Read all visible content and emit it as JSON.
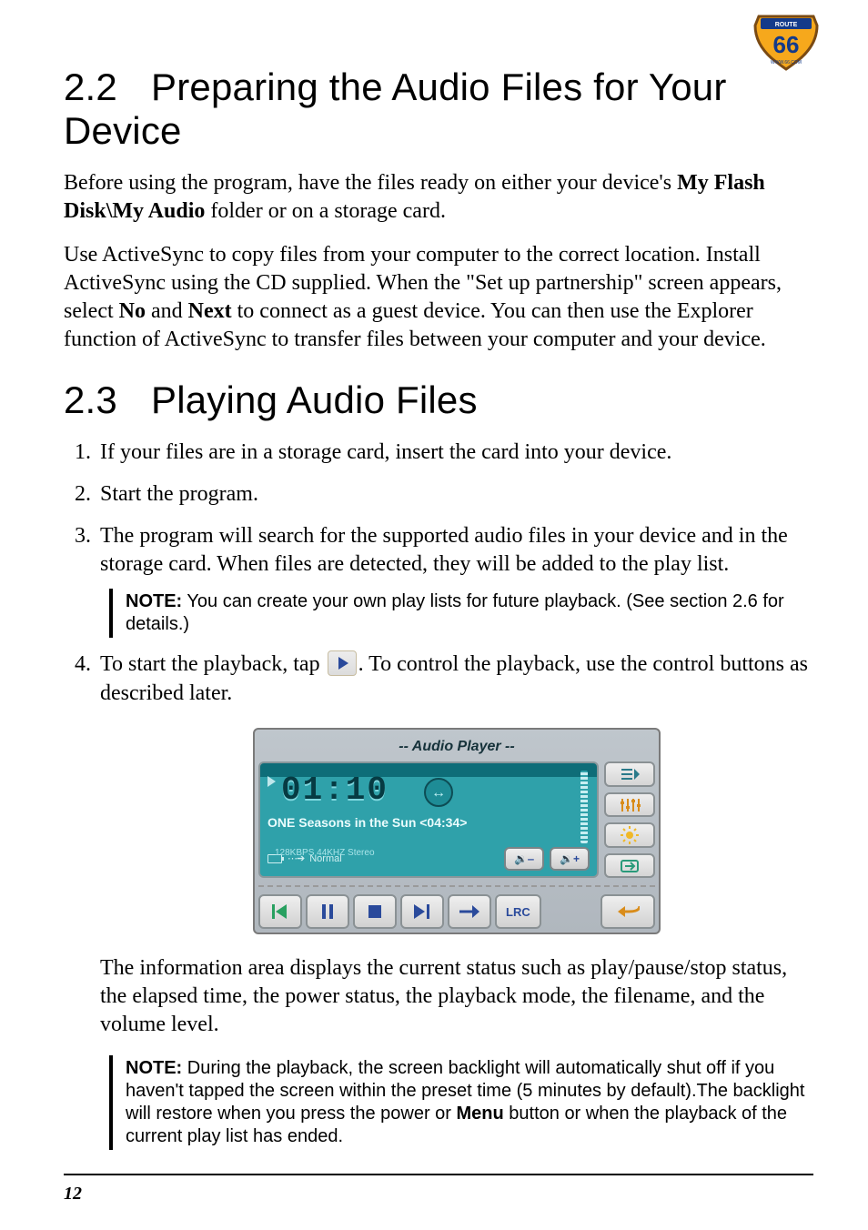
{
  "logo": {
    "route": "ROUTE",
    "num": "66",
    "url": "WWW.66.COM"
  },
  "section22": {
    "num": "2.2",
    "title": "Preparing the Audio Files for Your Device",
    "p1_a": "Before using the program, have the files ready on either your device's ",
    "p1_b": "My Flash Disk\\My Audio",
    "p1_c": " folder or on a storage card.",
    "p2": "Use ActiveSync to copy files from your computer to the correct location. Install ActiveSync using the CD supplied. When the \"Set up partnership\" screen appears, select ",
    "p2_no": "No",
    "p2_mid": " and ",
    "p2_next": "Next",
    "p2_tail": " to connect as a guest device. You can then use the Explorer function of ActiveSync to transfer files between your computer and your device."
  },
  "section23": {
    "num": "2.3",
    "title": "Playing Audio Files",
    "step1": "If your files are in a storage card, insert the card into your device.",
    "step2": "Start the program.",
    "step3": "The program will search for the supported audio files in your device and in the storage card. When files are detected, they will be added to the play list.",
    "note1_label": "NOTE:",
    "note1": " You can create your own play lists for future playback. (See section 2.6 for details.)",
    "step4_a": "To start the playback, tap ",
    "step4_b": ". To control the playback, use the control buttons as described later.",
    "info_para": "The information area displays the current status such as play/pause/stop status, the elapsed time, the power status, the playback mode, the filename, and the volume level.",
    "note2_label": "NOTE:",
    "note2_a": " During the playback, the screen backlight will automatically shut off if you haven't tapped the screen within the preset time (5 minutes by default).The backlight will restore when you press the power or ",
    "note2_menu": "Menu",
    "note2_b": " button or when the playback of the current play list has ended."
  },
  "player": {
    "title": "-- Audio Player --",
    "time": "01:10",
    "track": "ONE Seasons in the Sun <04:34>",
    "mode": "Normal",
    "kbps": "128KBPS 44KHZ Stereo",
    "vol_down": "🔉‒",
    "vol_up": "🔉+",
    "lrc": "LRC"
  },
  "page_number": "12"
}
